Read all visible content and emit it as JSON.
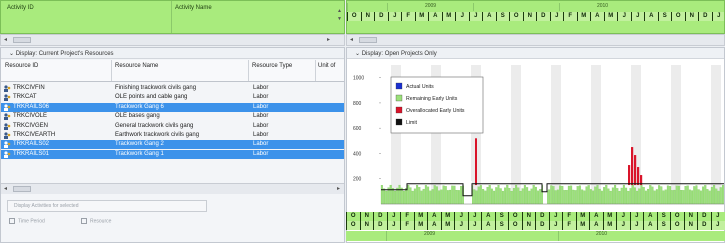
{
  "activity_header": {
    "col1": "Activity ID",
    "col2": "Activity Name"
  },
  "timescale": {
    "years": [
      "2009",
      "2010"
    ],
    "months": [
      "O",
      "N",
      "D",
      "J",
      "F",
      "M",
      "A",
      "M",
      "J",
      "J",
      "A",
      "S",
      "O",
      "N",
      "D",
      "J",
      "F",
      "M",
      "A",
      "M",
      "J",
      "J",
      "A",
      "S",
      "O",
      "N",
      "D",
      "J"
    ]
  },
  "resources": {
    "title": "Display: Current Project's Resources",
    "columns": [
      "Resource ID",
      "Resource Name",
      "Resource Type",
      "Unit of"
    ],
    "rows": [
      {
        "id": "TRKCIVFIN",
        "name": "Finishing trackwork civils gang",
        "type": "Labor",
        "selected": false
      },
      {
        "id": "TRKCAT",
        "name": "OLE points and cable gang",
        "type": "Labor",
        "selected": false
      },
      {
        "id": "TRKRAILS06",
        "name": "Trackwork Gang 6",
        "type": "Labor",
        "selected": true
      },
      {
        "id": "TRKCIVOLE",
        "name": "OLE bases gang",
        "type": "Labor",
        "selected": false
      },
      {
        "id": "TRKCIVGEN",
        "name": "General trackwork civils gang",
        "type": "Labor",
        "selected": false
      },
      {
        "id": "TRKCIVEARTH",
        "name": "Earthwork trackwork civils gang",
        "type": "Labor",
        "selected": false
      },
      {
        "id": "TRKRAILS02",
        "name": "Trackwork Gang 2",
        "type": "Labor",
        "selected": true
      },
      {
        "id": "TRKRAILS01",
        "name": "Trackwork Gang 1",
        "type": "Labor",
        "selected": true
      }
    ],
    "display_button": "Display Activities for selected",
    "checkbox_time_period": "Time Period",
    "checkbox_resource": "Resource"
  },
  "histogram": {
    "title": "Display: Open Projects Only",
    "legend": [
      "Actual Units",
      "Remaining Early Units",
      "Overallocated Early Units",
      "Limit"
    ],
    "colors": {
      "actual": "#1a2fd0",
      "remaining": "#9be07a",
      "overallocated": "#d9142a",
      "limit": "#111111",
      "header_green": "#a9eb7d",
      "selection_blue": "#3c92ea"
    }
  },
  "chart_data": {
    "type": "bar",
    "y_ticks": [
      1000,
      800,
      600,
      400,
      200
    ],
    "ylim": [
      0,
      1100
    ],
    "limit_value": 160,
    "remaining_level": 150,
    "overallocated_peak": 520,
    "series": [
      {
        "name": "Actual Units",
        "values": []
      },
      {
        "name": "Remaining Early Units",
        "values": [
          150
        ]
      },
      {
        "name": "Overallocated Early Units",
        "values": [
          520
        ]
      },
      {
        "name": "Limit",
        "values": [
          160
        ]
      }
    ]
  }
}
